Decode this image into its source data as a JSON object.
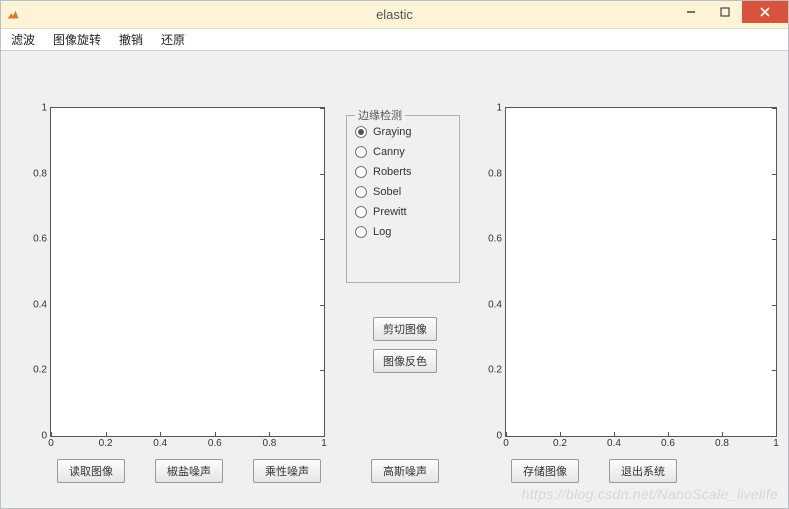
{
  "window": {
    "title": "elastic"
  },
  "menu": {
    "filter": "滤波",
    "rotate": "图像旋转",
    "undo": "撤销",
    "restore": "还原"
  },
  "axes_ticks": {
    "y": [
      "0",
      "0.2",
      "0.4",
      "0.6",
      "0.8",
      "1"
    ],
    "x": [
      "0",
      "0.2",
      "0.4",
      "0.6",
      "0.8",
      "1"
    ]
  },
  "panel": {
    "title": "边缘检测",
    "options": [
      "Graying",
      "Canny",
      "Roberts",
      "Sobel",
      "Prewitt",
      "Log"
    ],
    "selected": 0
  },
  "buttons": {
    "crop": "剪切图像",
    "invert": "图像反色",
    "read": "读取图像",
    "salt_noise": "椒盐噪声",
    "mult_noise": "乘性噪声",
    "gauss_noise": "高斯噪声",
    "save": "存储图像",
    "exit": "退出系统"
  },
  "watermark": "https://blog.csdn.net/NanoScale_livelife",
  "chart_data": [
    {
      "type": "scatter",
      "x": [],
      "y": [],
      "title": "",
      "xlabel": "",
      "ylabel": "",
      "xlim": [
        0,
        1
      ],
      "ylim": [
        0,
        1
      ]
    },
    {
      "type": "scatter",
      "x": [],
      "y": [],
      "title": "",
      "xlabel": "",
      "ylabel": "",
      "xlim": [
        0,
        1
      ],
      "ylim": [
        0,
        1
      ]
    }
  ]
}
